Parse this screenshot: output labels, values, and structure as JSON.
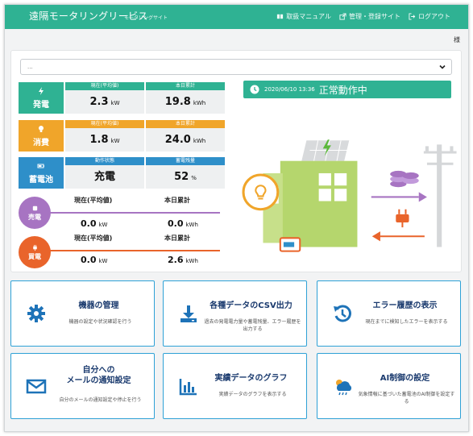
{
  "header": {
    "title": "遠隔モータリングリービス",
    "subtitle": "モータリングサイト",
    "links": [
      "取扱マニュアル",
      "管理・登録サイト",
      "ログアウト"
    ]
  },
  "user": {
    "suffix": "様"
  },
  "site_select": {
    "value": "..."
  },
  "metrics": {
    "generation": {
      "label": "発電",
      "h1": "現在(平均値)",
      "v1": "2.3",
      "u1": "kW",
      "h2": "本日累計",
      "v2": "19.8",
      "u2": "kWh"
    },
    "consumption": {
      "label": "消費",
      "h1": "現在(平均値)",
      "v1": "1.8",
      "u1": "kW",
      "h2": "本日累計",
      "v2": "24.0",
      "u2": "kWh"
    },
    "battery": {
      "label": "蓄電池",
      "h1": "動作状態",
      "v1": "充電",
      "h2": "蓄電残量",
      "v2": "52",
      "u2": "%"
    },
    "sell": {
      "label": "売電",
      "h1": "現在(平均値)",
      "v1": "0.0",
      "u1": "kW",
      "h2": "本日累計",
      "v2": "0.0",
      "u2": "kWh"
    },
    "buy": {
      "label": "買電",
      "h1": "現在(平均値)",
      "v1": "0.0",
      "u1": "kW",
      "h2": "本日累計",
      "v2": "2.6",
      "u2": "kWh"
    }
  },
  "status": {
    "timestamp": "2020/06/10 13:36",
    "text": "正常動作中"
  },
  "cards": [
    {
      "title": "機器の管理",
      "desc": "機器の設定や状況確認を行う",
      "icon": "gear-icon"
    },
    {
      "title": "各種データのCSV出力",
      "desc": "過去の発電電力量や蓄電残量、エラー履歴を出力する",
      "icon": "download-icon"
    },
    {
      "title": "エラー履歴の表示",
      "desc": "現在までに検知したエラーを表示する",
      "icon": "history-icon"
    },
    {
      "title": "自分への\nメールの通知設定",
      "desc": "自分のメールの通知設定や停止を行う",
      "icon": "mail-icon"
    },
    {
      "title": "実績データのグラフ",
      "desc": "実績データのグラフを表示する",
      "icon": "bar-chart-icon"
    },
    {
      "title": "AI制御の設定",
      "desc": "気象情報に基づいた蓄電池のAI制御を設定する",
      "icon": "weather-icon"
    }
  ],
  "colors": {
    "header": "#2fb293",
    "generation": "#2fb293",
    "consumption": "#f0a52a",
    "battery": "#2e8fc9",
    "sell": "#a774c2",
    "buy": "#e9642b",
    "card_border": "#2ea1d6",
    "card_icon": "#1e73b8"
  }
}
